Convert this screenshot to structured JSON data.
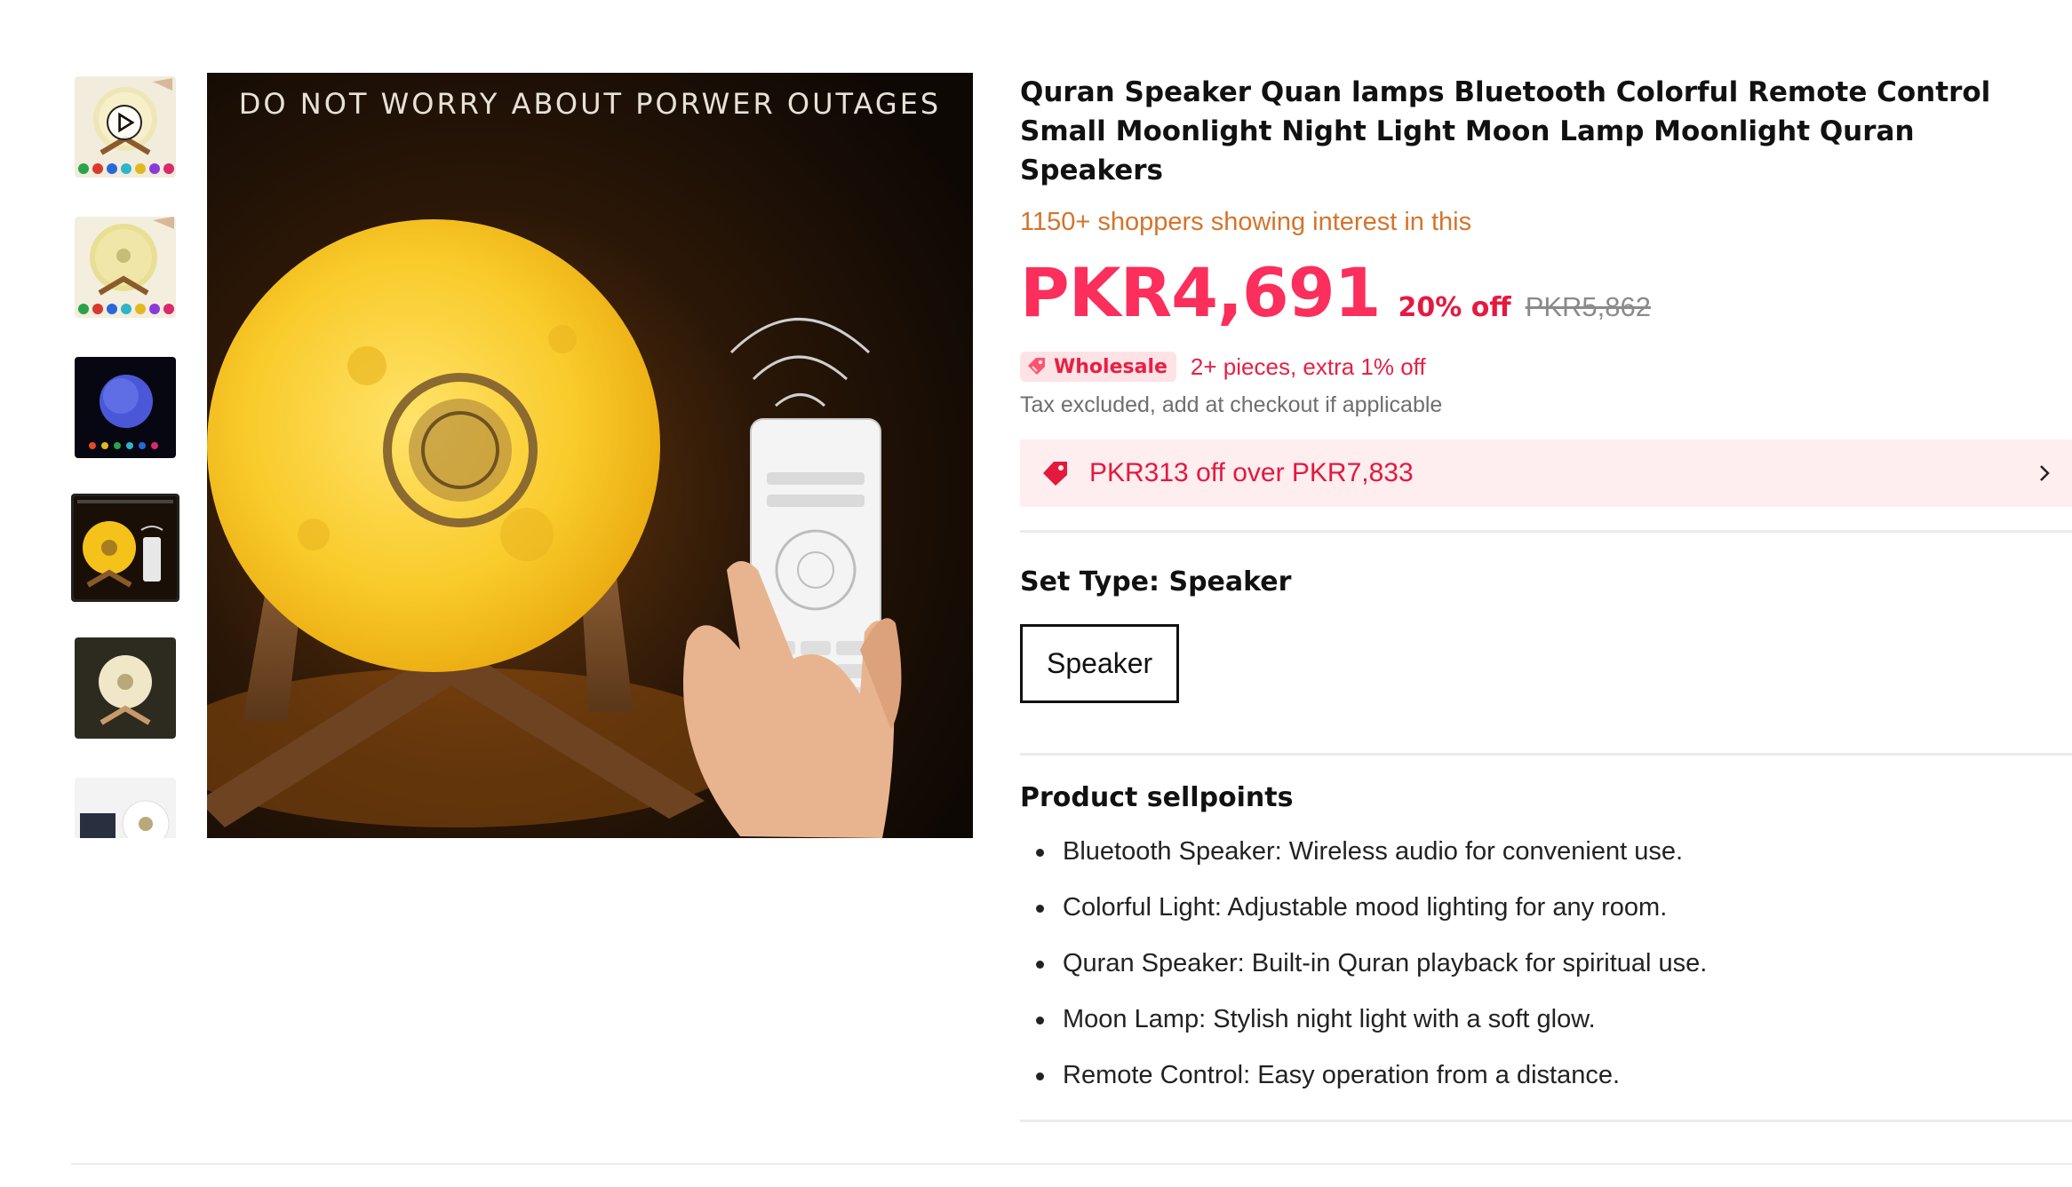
{
  "gallery": {
    "main_caption": "DO NOT WORRY ABOUT PORWER OUTAGES",
    "thumbnails": [
      {
        "name": "thumb-video"
      },
      {
        "name": "thumb-moon-colors"
      },
      {
        "name": "thumb-blue-moon"
      },
      {
        "name": "thumb-main"
      },
      {
        "name": "thumb-moon-stand"
      },
      {
        "name": "thumb-box"
      }
    ],
    "active_index": 3
  },
  "product": {
    "title": "Quran Speaker Quan lamps Bluetooth Colorful Remote Control Small Moonlight Night Light Moon Lamp Moonlight Quran Speakers",
    "interest": "1150+ shoppers showing interest in this",
    "price": "PKR4,691",
    "discount": "20% off",
    "original_price": "PKR5,862",
    "wholesale_badge": "Wholesale",
    "wholesale_text": "2+ pieces, extra 1% off",
    "tax_note": "Tax excluded, add at checkout if applicable",
    "coupon": "PKR313 off over PKR7,833"
  },
  "set_type": {
    "label": "Set Type: ",
    "selected": "Speaker",
    "options": [
      "Speaker"
    ]
  },
  "sellpoints": {
    "title": "Product sellpoints",
    "items": [
      "Bluetooth Speaker: Wireless audio for convenient use.",
      "Colorful Light: Adjustable mood lighting for any room.",
      "Quran Speaker: Built-in Quran playback for spiritual use.",
      "Moon Lamp: Stylish night light with a soft glow.",
      "Remote Control: Easy operation from a distance."
    ]
  },
  "colors": {
    "price": "#fb2e5c",
    "discount": "#e5193f",
    "interest": "#d4742b",
    "coupon_bg": "#ffeef0",
    "coupon_text": "#e3193d",
    "wholesale_bg": "#fde3e6"
  },
  "icons": {
    "play": "play-icon",
    "tag": "tag-icon",
    "chevron": "chevron-right-icon",
    "wholesale": "wholesale-tag-icon"
  }
}
